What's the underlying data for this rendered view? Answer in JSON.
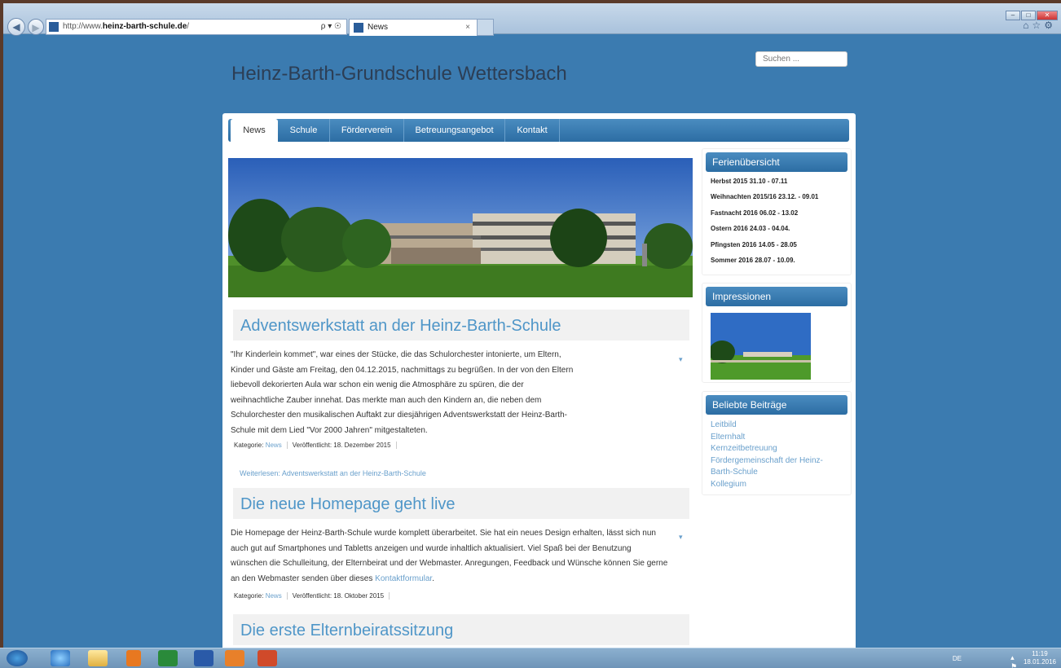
{
  "browser": {
    "url_prefix": "http://www.",
    "url_domain": "heinz-barth-schule.de",
    "url_suffix": "/",
    "address_tools": "ρ ▾ ☉",
    "tab_title": "News",
    "tab_close": "×"
  },
  "site": {
    "title": "Heinz-Barth-Grundschule Wettersbach",
    "search_placeholder": "Suchen ..."
  },
  "nav": [
    "News",
    "Schule",
    "Förderverein",
    "Betreuungsangebot",
    "Kontakt"
  ],
  "articles": [
    {
      "title": "Adventswerkstatt an der Heinz-Barth-Schule",
      "lines": [
        "\"Ihr Kinderlein kommet\", war eines der Stücke, die das Schulorchester  intonierte,  um Eltern,",
        "Kinder und Gäste am Freitag, den 04.12.2015, nachmittags zu begrüßen. In der von den Eltern",
        "liebevoll dekorierten Aula war schon ein wenig die Atmosphäre zu spüren, die der",
        "weihnachtliche Zauber innehat. Das merkte man auch den Kindern an, die neben dem",
        "Schulorchester den musikalischen Auftakt zur diesjährigen Adventswerkstatt der Heinz-Barth-",
        "Schule mit dem Lied \"Vor 2000 Jahren\" mitgestalteten."
      ],
      "category_label": "Kategorie:",
      "category": "News",
      "published": "Veröffentlicht: 18. Dezember 2015",
      "readmore": "Weiterlesen: Adventswerkstatt an der Heinz-Barth-Schule"
    },
    {
      "title": "Die neue Homepage geht live",
      "lines": [
        "Die Homepage der Heinz-Barth-Schule wurde komplett überarbeitet. Sie hat ein neues Design erhalten, lässt sich nun",
        "auch gut auf Smartphones und Tabletts anzeigen und wurde inhaltlich aktualisiert. Viel Spaß bei der Benutzung",
        "wünschen die Schulleitung, der Elternbeirat und der Webmaster. Anregungen, Feedback und Wünsche können Sie gerne"
      ],
      "last_line": "an den Webmaster senden über dieses ",
      "last_link": "Kontaktformular",
      "last_end": ".",
      "category_label": "Kategorie:",
      "category": "News",
      "published": "Veröffentlicht: 18. Oktober 2015"
    },
    {
      "title": "Die erste Elternbeiratssitzung"
    }
  ],
  "sidebar": {
    "holidays_title": "Ferienübersicht",
    "holidays": [
      "Herbst 2015   31.10 - 07.11",
      "Weihnachten 2015/16   23.12. - 09.01",
      "Fastnacht 2016   06.02 - 13.02",
      "Ostern 2016   24.03 - 04.04.",
      "Pfingsten 2016  14.05 - 28.05",
      "Sommer 2016   28.07 - 10.09."
    ],
    "impressions_title": "Impressionen",
    "popular_title": "Beliebte Beiträge",
    "popular": [
      "Leitbild",
      "Elternhalt",
      "Kernzeitbetreuung",
      "Fördergemeinschaft der Heinz-",
      "Barth-Schule",
      "Kollegium"
    ]
  },
  "tray": {
    "lang": "DE",
    "time": "11:19",
    "date": "18.01.2016"
  },
  "colors": {
    "page_bg": "#3b7bb0",
    "accent": "#4f96c8",
    "nav": "#2c6da3"
  }
}
